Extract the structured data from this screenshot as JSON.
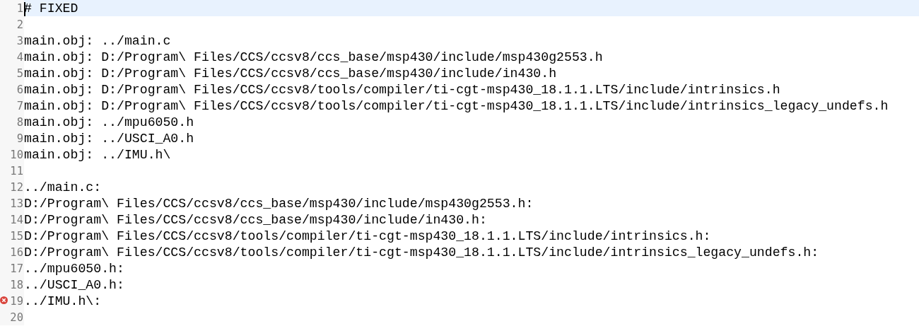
{
  "editor": {
    "lines": [
      {
        "number": "1",
        "text": "# FIXED",
        "current": true,
        "error": false
      },
      {
        "number": "2",
        "current": false,
        "error": false
      },
      {
        "number": "3",
        "text": "main.obj: ../main.c",
        "current": false,
        "error": false
      },
      {
        "number": "4",
        "text": "main.obj: D:/Program\\ Files/CCS/ccsv8/ccs_base/msp430/include/msp430g2553.h",
        "current": false,
        "error": false
      },
      {
        "number": "5",
        "text": "main.obj: D:/Program\\ Files/CCS/ccsv8/ccs_base/msp430/include/in430.h",
        "current": false,
        "error": false
      },
      {
        "number": "6",
        "text": "main.obj: D:/Program\\ Files/CCS/ccsv8/tools/compiler/ti-cgt-msp430_18.1.1.LTS/include/intrinsics.h",
        "current": false,
        "error": false
      },
      {
        "number": "7",
        "text": "main.obj: D:/Program\\ Files/CCS/ccsv8/tools/compiler/ti-cgt-msp430_18.1.1.LTS/include/intrinsics_legacy_undefs.h",
        "current": false,
        "error": false
      },
      {
        "number": "8",
        "text": "main.obj: ../mpu6050.h",
        "current": false,
        "error": false
      },
      {
        "number": "9",
        "text": "main.obj: ../USCI_A0.h",
        "current": false,
        "error": false
      },
      {
        "number": "10",
        "text": "main.obj: ../IMU.h\\",
        "current": false,
        "error": false
      },
      {
        "number": "11",
        "current": false,
        "error": false
      },
      {
        "number": "12",
        "text": "../main.c:",
        "current": false,
        "error": false
      },
      {
        "number": "13",
        "text": "D:/Program\\ Files/CCS/ccsv8/ccs_base/msp430/include/msp430g2553.h:",
        "current": false,
        "error": false
      },
      {
        "number": "14",
        "text": "D:/Program\\ Files/CCS/ccsv8/ccs_base/msp430/include/in430.h:",
        "current": false,
        "error": false
      },
      {
        "number": "15",
        "text": "D:/Program\\ Files/CCS/ccsv8/tools/compiler/ti-cgt-msp430_18.1.1.LTS/include/intrinsics.h:",
        "current": false,
        "error": false
      },
      {
        "number": "16",
        "text": "D:/Program\\ Files/CCS/ccsv8/tools/compiler/ti-cgt-msp430_18.1.1.LTS/include/intrinsics_legacy_undefs.h:",
        "current": false,
        "error": false
      },
      {
        "number": "17",
        "text": "../mpu6050.h:",
        "current": false,
        "error": false
      },
      {
        "number": "18",
        "text": "../USCI_A0.h:",
        "current": false,
        "error": false
      },
      {
        "number": "19",
        "text": "../IMU.h\\:",
        "current": false,
        "error": true
      },
      {
        "number": "20",
        "current": false,
        "error": false
      }
    ]
  }
}
